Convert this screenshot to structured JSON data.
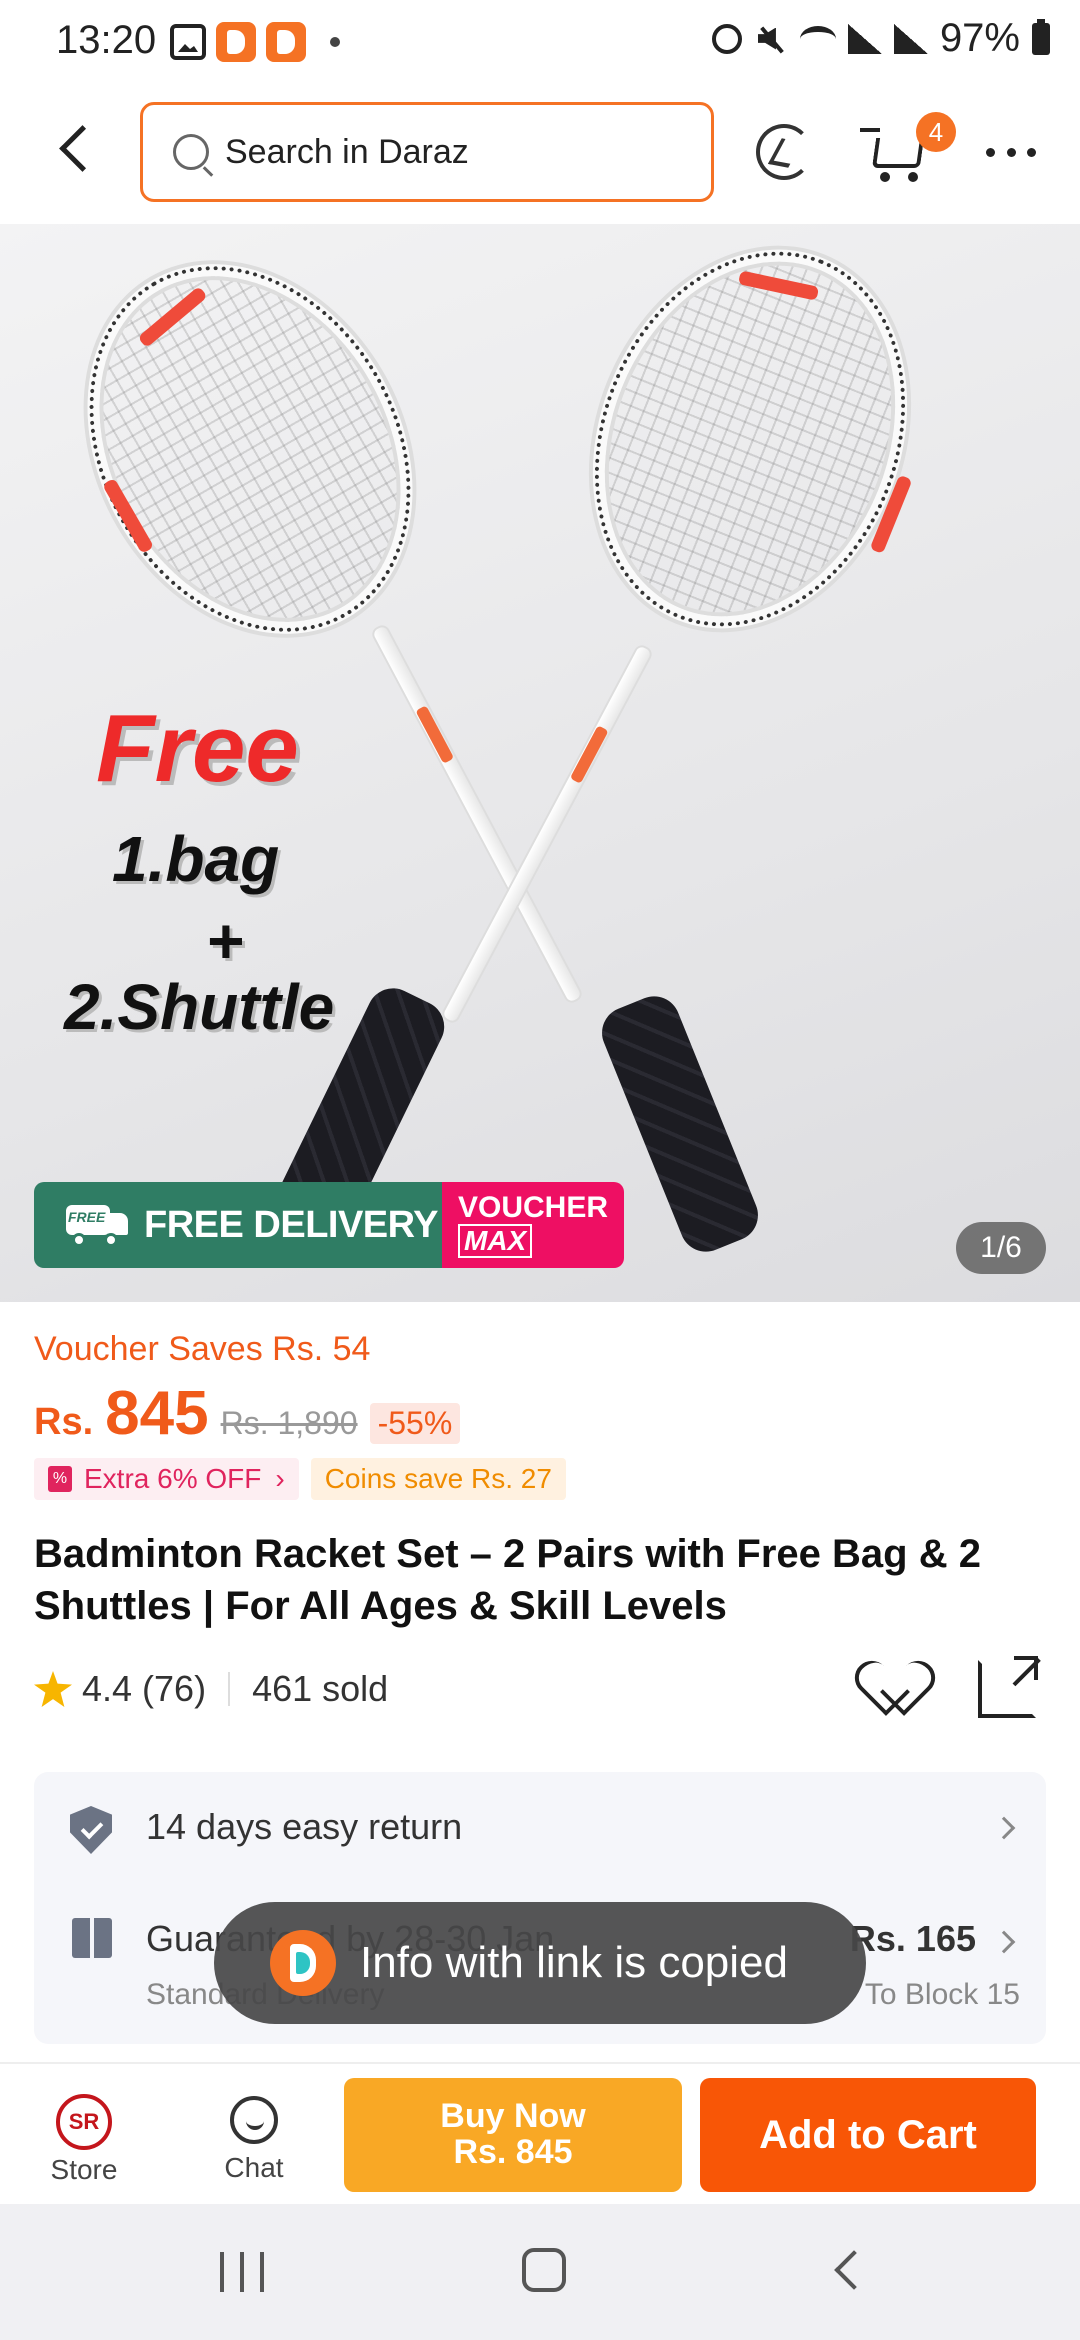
{
  "status_bar": {
    "time": "13:20",
    "battery": "97%"
  },
  "header": {
    "search_placeholder": "Search in Daraz",
    "cart_count": "4"
  },
  "product_image": {
    "promo_free": "Free",
    "promo_bag": "1.bag",
    "promo_plus": "+",
    "promo_shuttle": "2.Shuttle",
    "banner_delivery": "FREE DELIVERY",
    "banner_free_tag": "FREE",
    "banner_voucher": "VOUCHER",
    "banner_max": "MAX",
    "page_indicator": "1/6"
  },
  "price": {
    "voucher_saves": "Voucher Saves Rs. 54",
    "currency": "Rs.",
    "current": "845",
    "original": "Rs. 1,890",
    "discount": "-55%",
    "extra_tag": "Extra 6% OFF",
    "coins_tag": "Coins save Rs. 27"
  },
  "product": {
    "title": "Badminton Racket Set – 2 Pairs with Free Bag & 2 Shuttles | For All Ages & Skill Levels",
    "rating": "4.4 (76)",
    "sold": "461 sold"
  },
  "info": {
    "return": "14 days easy return",
    "delivery_title": "Guaranteed by 28-30 Jan",
    "delivery_sub": "Standard Delivery",
    "delivery_price": "Rs. 165",
    "delivery_dest": "To Block 15"
  },
  "toast": {
    "text": "Info with link is copied"
  },
  "bottom_bar": {
    "store": "Store",
    "store_logo": "SR",
    "chat": "Chat",
    "buy_now_line1": "Buy Now",
    "buy_now_line2": "Rs. 845",
    "add_to_cart": "Add to Cart"
  },
  "colors": {
    "brand_orange": "#f57224",
    "price_orange": "#f05a1a",
    "buy_now": "#f9a825",
    "add_to_cart": "#f85606",
    "free_delivery_green": "#2f7d64",
    "voucher_pink": "#ee0f63"
  }
}
